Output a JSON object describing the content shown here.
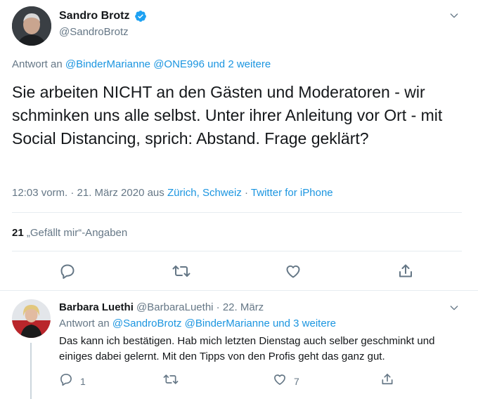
{
  "main_tweet": {
    "author_name": "Sandro Brotz",
    "author_handle": "@SandroBrotz",
    "reply_prefix": "Antwort an",
    "reply_user1": "@BinderMarianne",
    "reply_user2": "@ONE996",
    "reply_more": "und 2 weitere",
    "text": "Sie arbeiten NICHT an den Gästen und Moderatoren - wir schminken uns alle selbst. Unter ihrer Anleitung vor Ort - mit Social Distancing, sprich: Abstand. Frage geklärt?",
    "timestamp": "12:03 vorm. · 21. März 2020 aus",
    "location": "Zürich, Schweiz",
    "separator": "·",
    "client": "Twitter for iPhone",
    "likes_count": "21",
    "likes_label": "„Gefällt mir“-Angaben"
  },
  "reply_tweet": {
    "author_name": "Barbara Luethi",
    "author_handle": "@BarbaraLuethi",
    "date": "· 22. März",
    "reply_prefix": "Antwort an",
    "reply_user1": "@SandroBrotz",
    "reply_user2": "@BinderMarianne",
    "reply_more": "und 3 weitere",
    "text": "Das kann ich bestätigen. Hab mich letzten Dienstag auch selber geschminkt und einiges dabei gelernt. Mit den Tipps von den Profis geht das ganz gut.",
    "reply_count": "1",
    "like_count": "7"
  },
  "icons": {
    "verified": "verified-badge-icon",
    "chevron": "chevron-down-icon",
    "reply": "reply-icon",
    "retweet": "retweet-icon",
    "like": "heart-icon",
    "share": "share-icon"
  },
  "colors": {
    "link": "#1b95e0",
    "secondary_text": "#657786",
    "divider": "#e6ecf0",
    "thread_line": "#ccd6dd"
  }
}
